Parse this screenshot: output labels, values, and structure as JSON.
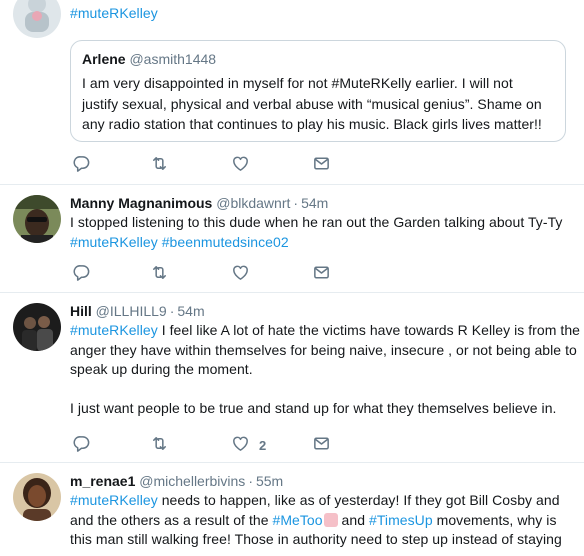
{
  "tweets": [
    {
      "avatar": "avatar-top",
      "text_parts": [
        {
          "t": "#muteRKelley",
          "tag": true
        }
      ],
      "quote": {
        "name": "Arlene",
        "handle": "@asmith1448",
        "text": "I am very disappointed in myself for not #MuteRKelly earlier. I will not justify sexual, physical and verbal abuse with “musical genius”. Shame on any radio station that continues to play his music. Black girls lives matter!!"
      },
      "likes": ""
    },
    {
      "name": "Manny Magnanimous",
      "handle": "@blkdawnrt",
      "time": "54m",
      "line1": "I stopped listening to this dude when he ran out the Garden talking about Ty-Ty",
      "tags": [
        "#muteRKelley",
        "#beenmutedsince02"
      ],
      "likes": ""
    },
    {
      "name": "Hill",
      "handle": "@ILLHILL9",
      "time": "54m",
      "tag": "#muteRKelley",
      "body1": " I feel like A lot of hate the victims have towards R Kelley is from the anger they have within themselves for being naive, insecure , or not being able to speak up during the moment.",
      "body2": "I just want people to be true and stand up for what they themselves believe in.",
      "likes": "2"
    },
    {
      "name": "m_renae1",
      "handle": "@michellerbivins",
      "time": "55m",
      "tag1": "#muteRKelley",
      "body1": " needs to happen, like as of yesterday! If they got Bill Cosby and and the others as a result of the ",
      "tag2": "#MeToo",
      "body2": " and ",
      "tag3": "#TimesUp",
      "body3": " movements, why is this man still walking free! Those in authority need to step up instead of staying"
    }
  ],
  "colors": {
    "link": "#1b95e0",
    "muted": "#657786",
    "border": "#e6ecf0"
  },
  "icons": [
    "reply-icon",
    "retweet-icon",
    "like-icon",
    "message-icon"
  ]
}
